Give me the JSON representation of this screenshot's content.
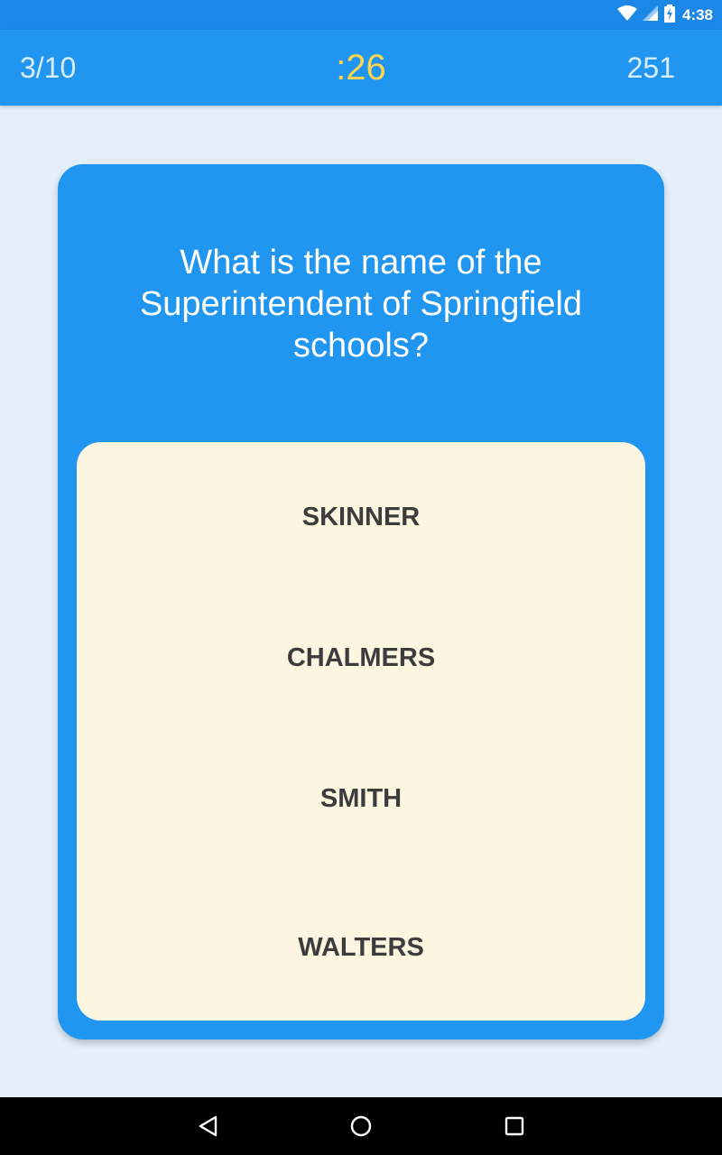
{
  "status_bar": {
    "time": "4:38",
    "icons": [
      "wifi-icon",
      "signal-icon",
      "battery-charging-icon"
    ]
  },
  "header": {
    "progress": "3/10",
    "timer": ":26",
    "score": "251"
  },
  "question": {
    "text": "What is the name of the Superintendent of Springfield schools?"
  },
  "answers": [
    {
      "label": "SKINNER"
    },
    {
      "label": "CHALMERS"
    },
    {
      "label": "SMITH"
    },
    {
      "label": "WALTERS"
    }
  ],
  "nav_bar": {
    "icons": [
      "back-icon",
      "home-icon",
      "recents-icon"
    ]
  },
  "colors": {
    "app_bar": "#2196f0",
    "status_bar": "#1b87e6",
    "background": "#e3f0fb",
    "timer": "#ffd54f",
    "answer_panel": "#fcf6e0",
    "answer_text": "#3c3c3c"
  }
}
